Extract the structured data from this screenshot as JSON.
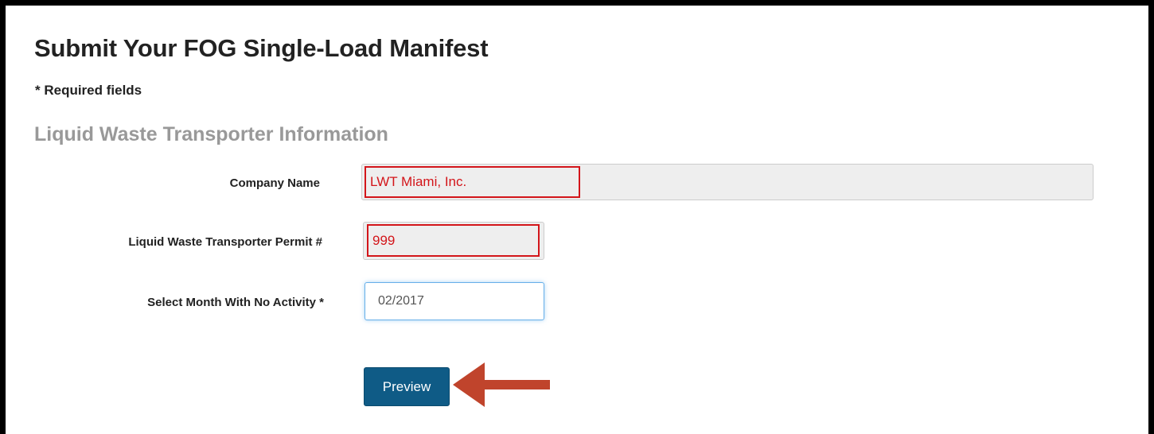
{
  "page": {
    "title": "Submit Your FOG Single-Load Manifest",
    "required_note": "* Required fields",
    "section_title": "Liquid Waste Transporter Information"
  },
  "form": {
    "company_name": {
      "label": "Company Name",
      "value": "LWT Miami, Inc."
    },
    "permit": {
      "label": "Liquid Waste Transporter Permit #",
      "value": "999"
    },
    "month": {
      "label": "Select Month With No Activity *",
      "value": "02/2017"
    },
    "preview_label": "Preview"
  },
  "annotation": {
    "arrow_color": "#c0442c",
    "highlight_color": "#d3151a"
  },
  "colors": {
    "button": "#0f5b86",
    "section_title": "#999999",
    "readonly_bg": "#eeeeee"
  }
}
